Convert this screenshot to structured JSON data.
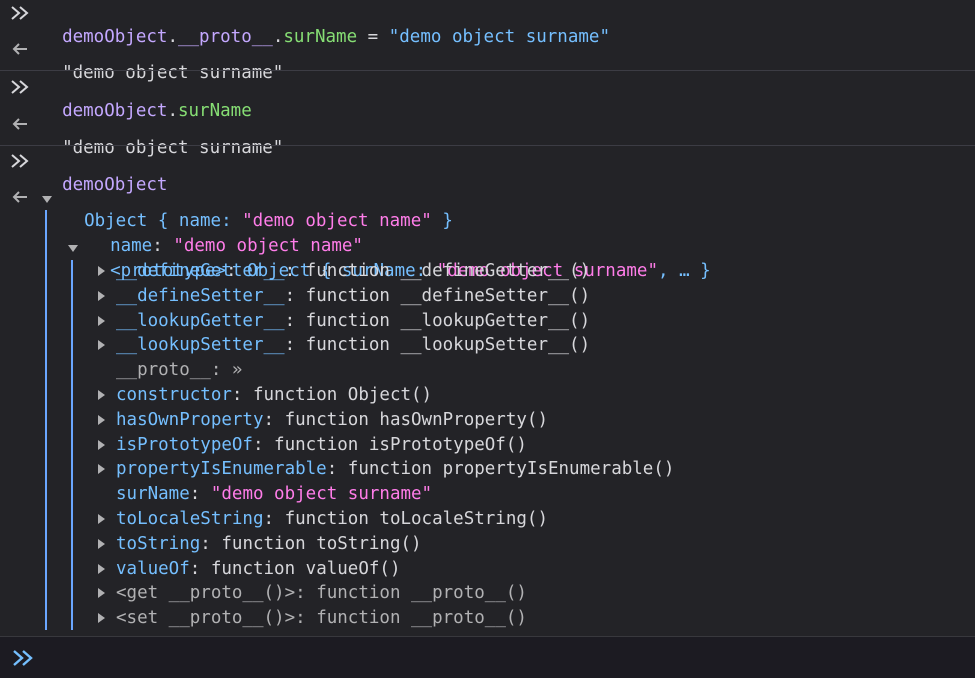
{
  "colors": {
    "background": "#232327",
    "input_background": "#1c1b22",
    "variable": "#c4a8ff",
    "property": "#75bfff",
    "string": "#ff7de9",
    "accent": "#75bfff",
    "guide": "#6aa6ff"
  },
  "entries": [
    {
      "input": {
        "object": "demoObject",
        "dot1": ".",
        "proto": "__proto__",
        "dot2": ".",
        "prop": "surName",
        "assign": " = ",
        "value": "\"demo object surname\""
      },
      "output": "\"demo object surname\""
    },
    {
      "input": {
        "object": "demoObject",
        "dot": ".",
        "prop": "surName"
      },
      "output": "\"demo object surname\""
    },
    {
      "input": {
        "object": "demoObject"
      }
    }
  ],
  "object_tree": {
    "header": {
      "type": "Object",
      "open": " { ",
      "key": "name",
      "colon": ": ",
      "value": "\"demo object name\"",
      "close": " }"
    },
    "name_row": {
      "key": "name",
      "colon": ": ",
      "value": "\"demo object name\""
    },
    "prototype_row": {
      "key": "<prototype>",
      "colon": ": ",
      "type": "Object",
      "open": " { ",
      "inner_key": "surName",
      "inner_colon": ": ",
      "inner_value": "\"demo object surname\"",
      "rest": ", … }"
    },
    "children": [
      {
        "key": "__defineGetter__",
        "sep": ": ",
        "value": "function __defineGetter__()",
        "expandable": true,
        "dim": false
      },
      {
        "key": "__defineSetter__",
        "sep": ": ",
        "value": "function __defineSetter__()",
        "expandable": true,
        "dim": false
      },
      {
        "key": "__lookupGetter__",
        "sep": ": ",
        "value": "function __lookupGetter__()",
        "expandable": true,
        "dim": false
      },
      {
        "key": "__lookupSetter__",
        "sep": ": ",
        "value": "function __lookupSetter__()",
        "expandable": true,
        "dim": false
      },
      {
        "key": "__proto__",
        "sep": ": ",
        "value": "»",
        "expandable": false,
        "dim": true
      },
      {
        "key": "constructor",
        "sep": ": ",
        "value": "function Object()",
        "expandable": true,
        "dim": false
      },
      {
        "key": "hasOwnProperty",
        "sep": ": ",
        "value": "function hasOwnProperty()",
        "expandable": true,
        "dim": false
      },
      {
        "key": "isPrototypeOf",
        "sep": ": ",
        "value": "function isPrototypeOf()",
        "expandable": true,
        "dim": false
      },
      {
        "key": "propertyIsEnumerable",
        "sep": ": ",
        "value": "function propertyIsEnumerable()",
        "expandable": true,
        "dim": false
      },
      {
        "key": "surName",
        "sep": ": ",
        "value": "\"demo object surname\"",
        "expandable": false,
        "dim": false,
        "string": true
      },
      {
        "key": "toLocaleString",
        "sep": ": ",
        "value": "function toLocaleString()",
        "expandable": true,
        "dim": false
      },
      {
        "key": "toString",
        "sep": ": ",
        "value": "function toString()",
        "expandable": true,
        "dim": false
      },
      {
        "key": "valueOf",
        "sep": ": ",
        "value": "function valueOf()",
        "expandable": true,
        "dim": false
      },
      {
        "key": "<get __proto__()>",
        "sep": ": ",
        "value": "function __proto__()",
        "expandable": true,
        "dim": true
      },
      {
        "key": "<set __proto__()>",
        "sep": ": ",
        "value": "function __proto__()",
        "expandable": true,
        "dim": true
      }
    ]
  },
  "input_bar": {
    "value": ""
  }
}
